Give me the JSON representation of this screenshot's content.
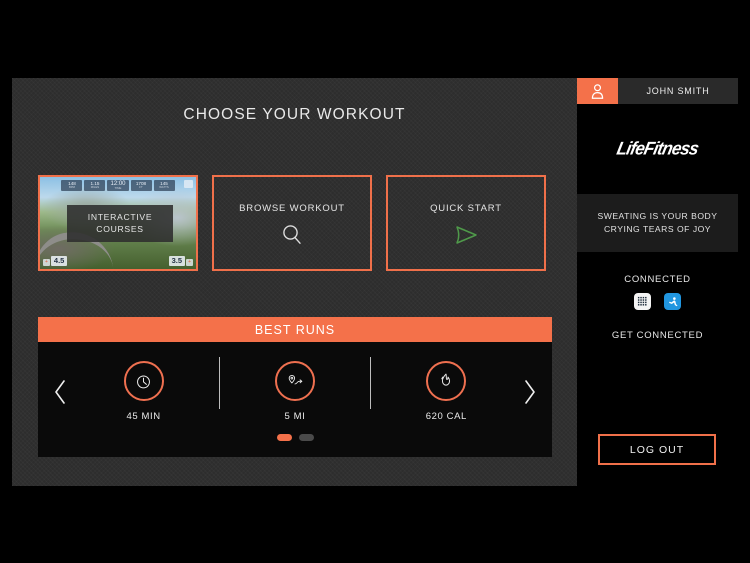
{
  "main": {
    "title": "CHOOSE YOUR WORKOUT",
    "tiles": [
      {
        "name": "interactive-courses",
        "label_line1": "INTERACTIVE",
        "label_line2": "COURSES",
        "icon": "course-thumbnail",
        "thumb": {
          "chips": [
            {
              "value": "148",
              "sub": "BPM"
            },
            {
              "value": "1.15",
              "sub": "MILES"
            },
            {
              "value": "12:00",
              "sub": "TIME"
            },
            {
              "value": "1708",
              "sub": "FT"
            },
            {
              "value": "145",
              "sub": "WATTS"
            }
          ],
          "bottom_left": "4.5",
          "bottom_right": "3.5",
          "plus": "+",
          "minus": "-"
        }
      },
      {
        "name": "browse-workout",
        "label": "BROWSE WORKOUT",
        "icon": "search-icon"
      },
      {
        "name": "quick-start",
        "label": "QUICK START",
        "icon": "play-icon"
      }
    ]
  },
  "best_runs": {
    "header": "BEST RUNS",
    "prev_arrow": "chevron-left-icon",
    "next_arrow": "chevron-right-icon",
    "stats": [
      {
        "icon": "clock-icon",
        "label": "45 MIN"
      },
      {
        "icon": "route-pin-icon",
        "label": "5 MI"
      },
      {
        "icon": "flame-icon",
        "label": "620 CAL"
      }
    ],
    "pagination": {
      "count": 2,
      "active_index": 0
    }
  },
  "sidebar": {
    "user_name": "JOHN SMITH",
    "avatar_icon": "user-icon",
    "brand": "LifeFitness",
    "quote_line1": "SWEATING IS YOUR BODY",
    "quote_line2": "CRYING TEARS OF JOY",
    "connected_title": "CONNECTED",
    "get_connected": "GET CONNECTED",
    "app_icons": [
      {
        "name": "myfitnesspal-icon"
      },
      {
        "name": "fitness-app-icon"
      }
    ],
    "logout_label": "LOG OUT"
  },
  "colors": {
    "accent_orange": "#f4714a",
    "tile_border": "#f0704a",
    "panel_bg": "#2d2d2d",
    "sidebar_bg": "#000000",
    "quick_start_green": "#5fa85a",
    "app_blue": "#2196e0"
  }
}
